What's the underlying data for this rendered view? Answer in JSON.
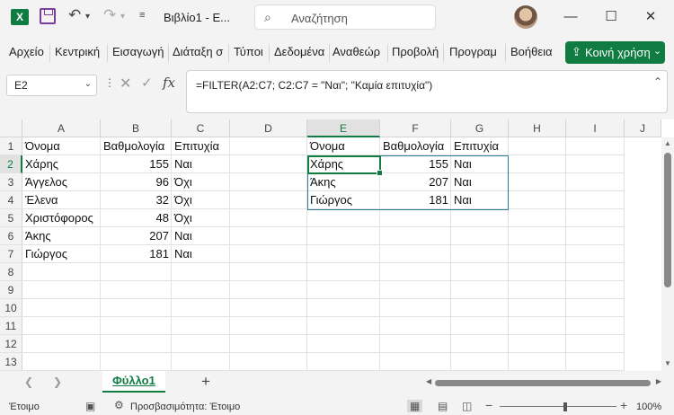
{
  "titlebar": {
    "logo": "X",
    "doc_title": "Βιβλίο1 - E...",
    "search_placeholder": "Αναζήτηση",
    "icons": [
      "excel-logo",
      "save-icon",
      "undo-icon",
      "redo-icon",
      "customize-qat-icon",
      "search-icon",
      "avatar",
      "minimize-icon",
      "maximize-icon",
      "close-icon"
    ]
  },
  "ribbon": {
    "tabs": [
      "Αρχείο",
      "Κεντρική",
      "Εισαγωγή",
      "Διάταξη σ",
      "Τύποι",
      "Δεδομένα",
      "Αναθεώρ",
      "Προβολή",
      "Προγραμ",
      "Βοήθεια"
    ],
    "share_label": "Κοινή χρήση"
  },
  "formula_bar": {
    "name_box": "E2",
    "fx": "fx",
    "formula": "=FILTER(A2:C7; C2:C7 = \"Ναι\"; \"Καμία επιτυχία\")"
  },
  "grid": {
    "columns": [
      "A",
      "B",
      "C",
      "D",
      "E",
      "F",
      "G",
      "H",
      "I",
      "J"
    ],
    "selected_column": "E",
    "rows": [
      "1",
      "2",
      "3",
      "4",
      "5",
      "6",
      "7",
      "8",
      "9",
      "10",
      "11",
      "12",
      "13"
    ],
    "selected_row": "2",
    "source_table": {
      "header": [
        "Όνομα",
        "Βαθμολογία",
        "Επιτυχία"
      ],
      "rows": [
        [
          "Χάρης",
          "155",
          "Ναι"
        ],
        [
          "Άγγελος",
          "96",
          "Όχι"
        ],
        [
          "Έλενα",
          "32",
          "Όχι"
        ],
        [
          "Χριστόφορος",
          "48",
          "Όχι"
        ],
        [
          "Άκης",
          "207",
          "Ναι"
        ],
        [
          "Γιώργος",
          "181",
          "Ναι"
        ]
      ]
    },
    "filtered_table": {
      "header": [
        "Όνομα",
        "Βαθμολογία",
        "Επιτυχία"
      ],
      "rows": [
        [
          "Χάρης",
          "155",
          "Ναι"
        ],
        [
          "Άκης",
          "207",
          "Ναι"
        ],
        [
          "Γιώργος",
          "181",
          "Ναι"
        ]
      ]
    }
  },
  "sheets": {
    "active": "Φύλλο1",
    "add": "+"
  },
  "status": {
    "ready": "Έτοιμο",
    "accessibility": "Προσβασιμότητα: Έτοιμο",
    "zoom": "100%"
  }
}
